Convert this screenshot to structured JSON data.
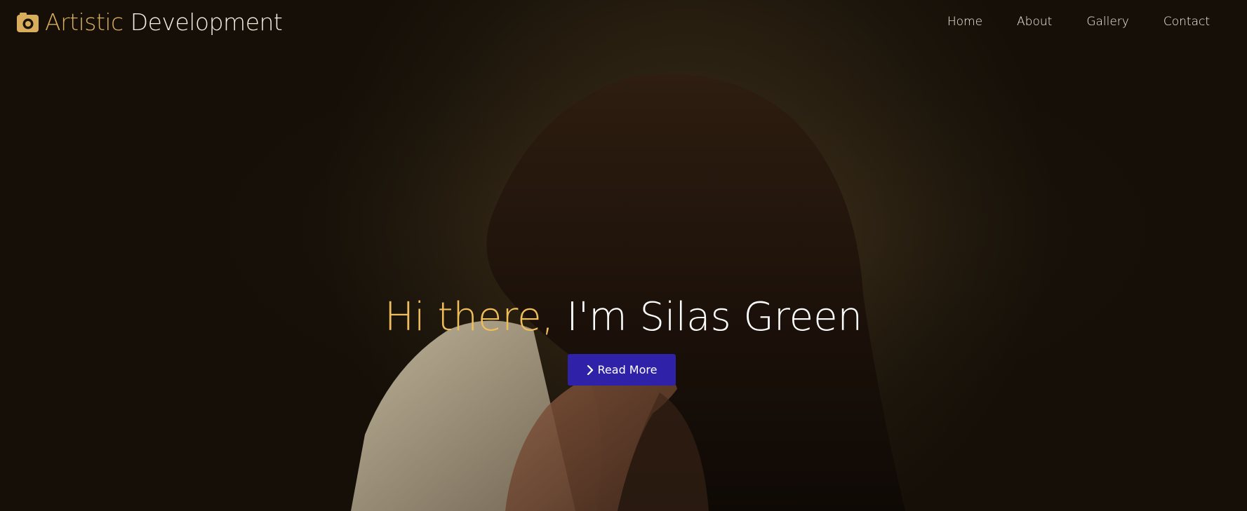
{
  "brand": {
    "icon": "camera-icon",
    "accent_text": "Artistic",
    "rest_text": "Development"
  },
  "nav": {
    "items": [
      {
        "label": "Home"
      },
      {
        "label": "About"
      },
      {
        "label": "Gallery"
      },
      {
        "label": "Contact"
      }
    ]
  },
  "hero": {
    "headline_accent": "Hi there,",
    "headline_rest": "I'm Silas Green",
    "cta_label": "Read More",
    "cta_icon": "chevron-right-icon"
  },
  "colors": {
    "brand_accent": "#d8ad5c",
    "headline_accent": "#f0bf5c",
    "cta_background": "#2f22a8",
    "background": "#1a140c"
  }
}
